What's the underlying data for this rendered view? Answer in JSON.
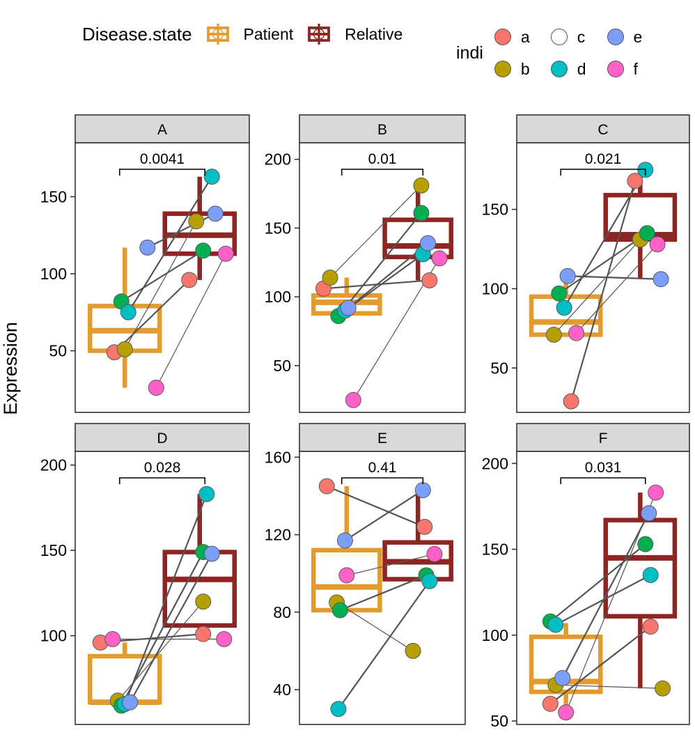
{
  "legend_disease": {
    "title": "Disease.state",
    "items": [
      {
        "label": "Patient",
        "color": "#E49B2E"
      },
      {
        "label": "Relative",
        "color": "#8E2522"
      }
    ]
  },
  "legend_indi": {
    "title": "indi",
    "items": [
      {
        "label": "a",
        "color": "#F8766D"
      },
      {
        "label": "c",
        "color": "#00B battery"
      },
      {
        "label": "e",
        "color": "#7B9FF9"
      },
      {
        "label": "b",
        "color": "#B79F00"
      },
      {
        "label": "d",
        "color": "#00BFC4"
      },
      {
        "label": "f",
        "color": "#FF61C9"
      }
    ]
  },
  "axis": {
    "ylabel": "Expression"
  },
  "colors": {
    "patient": "#E49B2E",
    "relative": "#8E2522",
    "strip_fill": "#d9d9d9",
    "panel_border": "#333333",
    "link": "#555555",
    "a": "#F8766D",
    "b": "#B79F00",
    "c": "#00B050",
    "d": "#00BFC4",
    "e": "#7B9FF9",
    "f": "#FF61C9"
  },
  "chart_data": {
    "type": "box",
    "title": "",
    "ylabel": "Expression",
    "xlabel": "",
    "groups": [
      "Patient",
      "Relative"
    ],
    "individuals": [
      "a",
      "b",
      "c",
      "d",
      "e",
      "f"
    ],
    "facets": [
      {
        "name": "A",
        "pvalue": "0.0041",
        "yticks": [
          50,
          100,
          150
        ],
        "ylim": [
          10,
          185
        ],
        "box_patient": {
          "min": 26,
          "q1": 50,
          "median": 63,
          "q3": 79,
          "max": 117
        },
        "box_relative": {
          "min": 96,
          "q1": 113,
          "median": 125,
          "q3": 139,
          "max": 163
        },
        "points": [
          {
            "indi": "a",
            "patient": 49,
            "relative": 96
          },
          {
            "indi": "b",
            "patient": 51,
            "relative": 134
          },
          {
            "indi": "c",
            "patient": 82,
            "relative": 115
          },
          {
            "indi": "d",
            "patient": 75,
            "relative": 163
          },
          {
            "indi": "e",
            "patient": 117,
            "relative": 139
          },
          {
            "indi": "f",
            "patient": 26,
            "relative": 113
          }
        ]
      },
      {
        "name": "B",
        "pvalue": "0.01",
        "yticks": [
          50,
          100,
          150,
          200
        ],
        "ylim": [
          16,
          212
        ],
        "box_patient": {
          "min": 86,
          "q1": 88,
          "median": 96,
          "q3": 101,
          "max": 114
        },
        "box_relative": {
          "min": 112,
          "q1": 129,
          "median": 137,
          "q3": 156,
          "max": 181
        },
        "points": [
          {
            "indi": "a",
            "patient": 106,
            "relative": 112
          },
          {
            "indi": "b",
            "patient": 114,
            "relative": 181
          },
          {
            "indi": "c",
            "patient": 86,
            "relative": 161
          },
          {
            "indi": "d",
            "patient": 90,
            "relative": 131
          },
          {
            "indi": "e",
            "patient": 92,
            "relative": 139
          },
          {
            "indi": "f",
            "patient": 25,
            "relative": 128
          }
        ]
      },
      {
        "name": "C",
        "pvalue": "0.021",
        "yticks": [
          50,
          100,
          150
        ],
        "ylim": [
          22,
          192
        ],
        "box_patient": {
          "min": 70,
          "q1": 71,
          "median": 79,
          "q3": 95,
          "max": 108
        },
        "box_relative": {
          "min": 106,
          "q1": 131,
          "median": 134,
          "q3": 159,
          "max": 175
        },
        "points": [
          {
            "indi": "a",
            "patient": 29,
            "relative": 168
          },
          {
            "indi": "b",
            "patient": 71,
            "relative": 131
          },
          {
            "indi": "c",
            "patient": 97,
            "relative": 135
          },
          {
            "indi": "d",
            "patient": 88,
            "relative": 175
          },
          {
            "indi": "e",
            "patient": 108,
            "relative": 106
          },
          {
            "indi": "f",
            "patient": 72,
            "relative": 128
          }
        ]
      },
      {
        "name": "D",
        "pvalue": "0.028",
        "yticks": [
          100,
          150,
          200
        ],
        "ylim": [
          48,
          208
        ],
        "box_patient": {
          "min": 60,
          "q1": 61,
          "median": 61,
          "q3": 88,
          "max": 96
        },
        "box_relative": {
          "min": 101,
          "q1": 106,
          "median": 133,
          "q3": 149,
          "max": 183
        },
        "points": [
          {
            "indi": "a",
            "patient": 96,
            "relative": 101
          },
          {
            "indi": "b",
            "patient": 62,
            "relative": 120
          },
          {
            "indi": "c",
            "patient": 59,
            "relative": 149
          },
          {
            "indi": "d",
            "patient": 60,
            "relative": 183
          },
          {
            "indi": "e",
            "patient": 61,
            "relative": 148
          },
          {
            "indi": "f",
            "patient": 98,
            "relative": 98
          }
        ]
      },
      {
        "name": "E",
        "pvalue": "0.41",
        "yticks": [
          40,
          80,
          120,
          160
        ],
        "ylim": [
          22,
          163
        ],
        "box_patient": {
          "min": 81,
          "q1": 81,
          "median": 93,
          "q3": 112,
          "max": 145
        },
        "box_relative": {
          "min": 96,
          "q1": 97,
          "median": 106,
          "q3": 116,
          "max": 143
        },
        "points": [
          {
            "indi": "a",
            "patient": 145,
            "relative": 124
          },
          {
            "indi": "b",
            "patient": 85,
            "relative": 60
          },
          {
            "indi": "c",
            "patient": 81,
            "relative": 99
          },
          {
            "indi": "d",
            "patient": 30,
            "relative": 96
          },
          {
            "indi": "e",
            "patient": 117,
            "relative": 143
          },
          {
            "indi": "f",
            "patient": 99,
            "relative": 110
          }
        ]
      },
      {
        "name": "F",
        "pvalue": "0.031",
        "yticks": [
          50,
          100,
          150,
          200
        ],
        "ylim": [
          48,
          207
        ],
        "box_patient": {
          "min": 56,
          "q1": 67,
          "median": 73,
          "q3": 99,
          "max": 107
        },
        "box_relative": {
          "min": 69,
          "q1": 111,
          "median": 145,
          "q3": 167,
          "max": 183
        },
        "points": [
          {
            "indi": "a",
            "patient": 60,
            "relative": 105
          },
          {
            "indi": "b",
            "patient": 71,
            "relative": 69
          },
          {
            "indi": "c",
            "patient": 108,
            "relative": 153
          },
          {
            "indi": "d",
            "patient": 106,
            "relative": 135
          },
          {
            "indi": "e",
            "patient": 75,
            "relative": 171
          },
          {
            "indi": "f",
            "patient": 55,
            "relative": 183
          }
        ]
      }
    ]
  }
}
